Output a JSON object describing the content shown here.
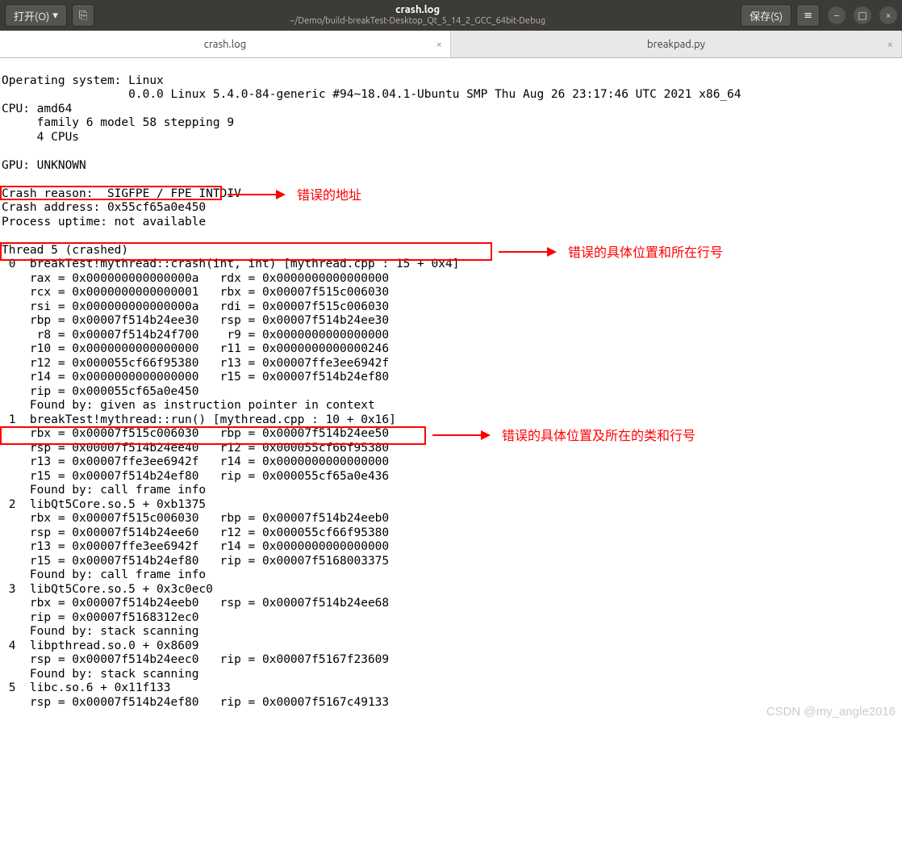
{
  "window": {
    "open_label": "打开(O)",
    "save_label": "保存(S)",
    "title": "crash.log",
    "subtitle": "~/Demo/build-breakTest-Desktop_Qt_5_14_2_GCC_64bit-Debug"
  },
  "tabs": [
    {
      "label": "crash.log"
    },
    {
      "label": "breakpad.py"
    }
  ],
  "content": "Operating system: Linux\n                  0.0.0 Linux 5.4.0-84-generic #94~18.04.1-Ubuntu SMP Thu Aug 26 23:17:46 UTC 2021 x86_64\nCPU: amd64\n     family 6 model 58 stepping 9\n     4 CPUs\n\nGPU: UNKNOWN\n\nCrash reason:  SIGFPE / FPE_INTDIV\nCrash address: 0x55cf65a0e450\nProcess uptime: not available\n\nThread 5 (crashed)\n 0  breakTest!mythread::crash(int, int) [mythread.cpp : 15 + 0x4]\n    rax = 0x000000000000000a   rdx = 0x0000000000000000\n    rcx = 0x0000000000000001   rbx = 0x00007f515c006030\n    rsi = 0x000000000000000a   rdi = 0x00007f515c006030\n    rbp = 0x00007f514b24ee30   rsp = 0x00007f514b24ee30\n     r8 = 0x00007f514b24f700    r9 = 0x0000000000000000\n    r10 = 0x0000000000000000   r11 = 0x0000000000000246\n    r12 = 0x000055cf66f95380   r13 = 0x00007ffe3ee6942f\n    r14 = 0x0000000000000000   r15 = 0x00007f514b24ef80\n    rip = 0x000055cf65a0e450\n    Found by: given as instruction pointer in context\n 1  breakTest!mythread::run() [mythread.cpp : 10 + 0x16]\n    rbx = 0x00007f515c006030   rbp = 0x00007f514b24ee50\n    rsp = 0x00007f514b24ee40   r12 = 0x000055cf66f95380\n    r13 = 0x00007ffe3ee6942f   r14 = 0x0000000000000000\n    r15 = 0x00007f514b24ef80   rip = 0x000055cf65a0e436\n    Found by: call frame info\n 2  libQt5Core.so.5 + 0xb1375\n    rbx = 0x00007f515c006030   rbp = 0x00007f514b24eeb0\n    rsp = 0x00007f514b24ee60   r12 = 0x000055cf66f95380\n    r13 = 0x00007ffe3ee6942f   r14 = 0x0000000000000000\n    r15 = 0x00007f514b24ef80   rip = 0x00007f5168003375\n    Found by: call frame info\n 3  libQt5Core.so.5 + 0x3c0ec0\n    rbx = 0x00007f514b24eeb0   rsp = 0x00007f514b24ee68\n    rip = 0x00007f5168312ec0\n    Found by: stack scanning\n 4  libpthread.so.0 + 0x8609\n    rsp = 0x00007f514b24eec0   rip = 0x00007f5167f23609\n    Found by: stack scanning\n 5  libc.so.6 + 0x11f133\n    rsp = 0x00007f514b24ef80   rip = 0x00007f5167c49133",
  "annotations": {
    "a1": "错误的地址",
    "a2": "错误的具体位置和所在行号",
    "a3": "错误的具体位置及所在的类和行号"
  },
  "watermark": "CSDN @my_angle2016"
}
